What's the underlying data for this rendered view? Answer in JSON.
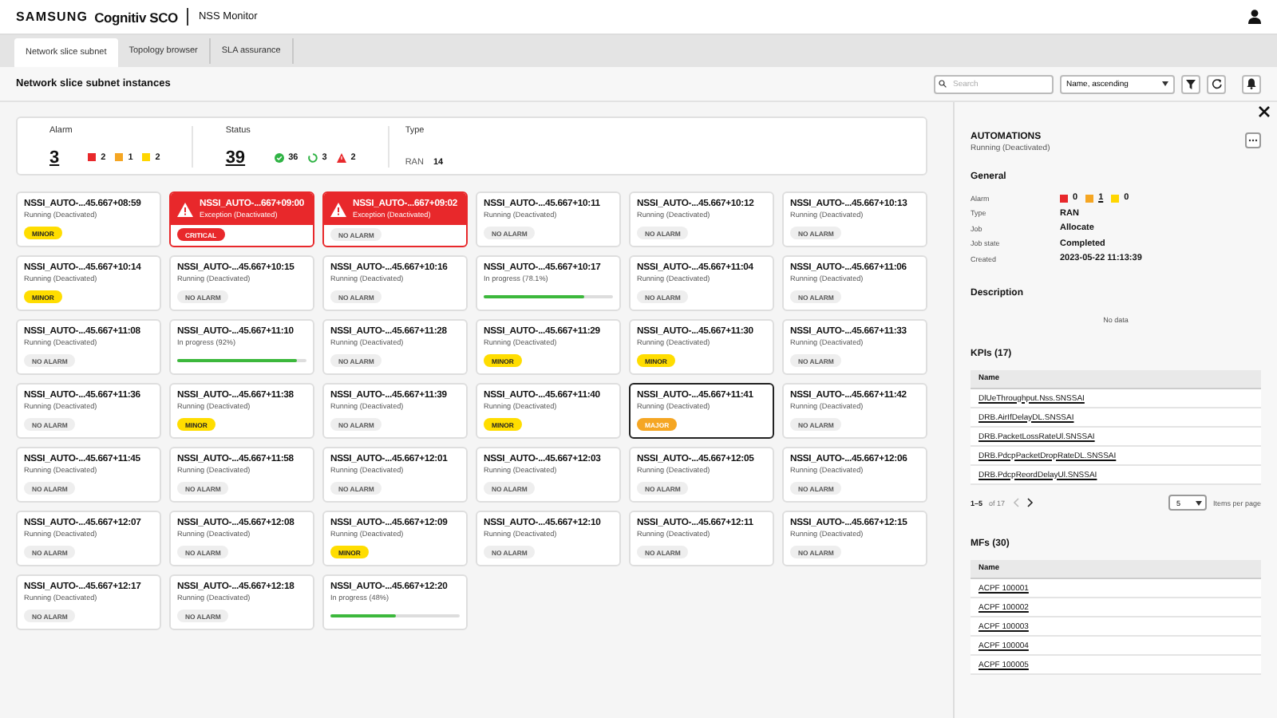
{
  "header": {
    "brand": "SAMSUNG",
    "product": "Cognitiv SCO",
    "app": "NSS Monitor"
  },
  "tabs": [
    {
      "label": "Network slice subnet",
      "selected": true
    },
    {
      "label": "Topology browser",
      "selected": false
    },
    {
      "label": "SLA assurance",
      "selected": false
    }
  ],
  "toolbar": {
    "title": "Network slice subnet instances",
    "search": {
      "placeholder": "Search"
    },
    "sort": "Name, ascending"
  },
  "summary": {
    "alarm": {
      "label": "Alarm",
      "total": "3",
      "counts": [
        {
          "color": "#e8282b",
          "count": "2"
        },
        {
          "color": "#f5a623",
          "count": "1"
        },
        {
          "color": "#ffd600",
          "count": "2"
        }
      ]
    },
    "status": {
      "label": "Status",
      "total": "39",
      "counts": [
        {
          "kind": "ok",
          "count": "36"
        },
        {
          "kind": "progress",
          "count": "3"
        },
        {
          "kind": "error",
          "count": "2"
        }
      ]
    },
    "type": {
      "label": "Type",
      "name": "RAN",
      "count": "14"
    }
  },
  "cards": [
    {
      "title": "NSSI_AUTO-...45.667+08:59",
      "status": "Running (Deactivated)",
      "kind": "normal",
      "badge": {
        "label": "MINOR",
        "color": "#ffdd00"
      },
      "selected": false
    },
    {
      "title": "NSSI_AUTO-...667+09:00",
      "status": "Exception (Deactivated)",
      "kind": "exception",
      "badge": {
        "label": "CRITICAL",
        "color": "#e8282b"
      },
      "selected": false
    },
    {
      "title": "NSSI_AUTO-...667+09:02",
      "status": "Exception (Deactivated)",
      "kind": "exception",
      "badge": {
        "label": "NO ALARM",
        "color": "#eeeeee"
      },
      "selected": false
    },
    {
      "title": "NSSI_AUTO-...45.667+10:11",
      "status": "Running (Deactivated)",
      "kind": "normal",
      "badge": {
        "label": "NO ALARM",
        "color": "#eeeeee"
      },
      "selected": false
    },
    {
      "title": "NSSI_AUTO-...45.667+10:12",
      "status": "Running (Deactivated)",
      "kind": "normal",
      "badge": {
        "label": "NO ALARM",
        "color": "#eeeeee"
      },
      "selected": false
    },
    {
      "title": "NSSI_AUTO-...45.667+10:13",
      "status": "Running (Deactivated)",
      "kind": "normal",
      "badge": {
        "label": "NO ALARM",
        "color": "#eeeeee"
      },
      "selected": false
    },
    {
      "title": "NSSI_AUTO-...45.667+10:14",
      "status": "Running (Deactivated)",
      "kind": "normal",
      "badge": {
        "label": "MINOR",
        "color": "#ffdd00"
      },
      "selected": false
    },
    {
      "title": "NSSI_AUTO-...45.667+10:15",
      "status": "Running (Deactivated)",
      "kind": "normal",
      "badge": {
        "label": "NO ALARM",
        "color": "#eeeeee"
      },
      "selected": false
    },
    {
      "title": "NSSI_AUTO-...45.667+10:16",
      "status": "Running (Deactivated)",
      "kind": "normal",
      "badge": {
        "label": "NO ALARM",
        "color": "#eeeeee"
      },
      "selected": false
    },
    {
      "title": "NSSI_AUTO-...45.667+10:17",
      "status": "In progress (78.1%)",
      "kind": "progress",
      "level": 0.78,
      "selected": false
    },
    {
      "title": "NSSI_AUTO-...45.667+11:04",
      "status": "Running (Deactivated)",
      "kind": "normal",
      "badge": {
        "label": "NO ALARM",
        "color": "#eeeeee"
      },
      "selected": false
    },
    {
      "title": "NSSI_AUTO-...45.667+11:06",
      "status": "Running (Deactivated)",
      "kind": "normal",
      "badge": {
        "label": "NO ALARM",
        "color": "#eeeeee"
      },
      "selected": false
    },
    {
      "title": "NSSI_AUTO-...45.667+11:08",
      "status": "Running (Deactivated)",
      "kind": "normal",
      "badge": {
        "label": "NO ALARM",
        "color": "#eeeeee"
      },
      "selected": false
    },
    {
      "title": "NSSI_AUTO-...45.667+11:10",
      "status": "In progress (92%)",
      "kind": "progress",
      "level": 0.92,
      "selected": false
    },
    {
      "title": "NSSI_AUTO-...45.667+11:28",
      "status": "Running (Deactivated)",
      "kind": "normal",
      "badge": {
        "label": "NO ALARM",
        "color": "#eeeeee"
      },
      "selected": false
    },
    {
      "title": "NSSI_AUTO-...45.667+11:29",
      "status": "Running (Deactivated)",
      "kind": "normal",
      "badge": {
        "label": "MINOR",
        "color": "#ffdd00"
      },
      "selected": false
    },
    {
      "title": "NSSI_AUTO-...45.667+11:30",
      "status": "Running (Deactivated)",
      "kind": "normal",
      "badge": {
        "label": "MINOR",
        "color": "#ffdd00"
      },
      "selected": false
    },
    {
      "title": "NSSI_AUTO-...45.667+11:33",
      "status": "Running (Deactivated)",
      "kind": "normal",
      "badge": {
        "label": "NO ALARM",
        "color": "#eeeeee"
      },
      "selected": false
    },
    {
      "title": "NSSI_AUTO-...45.667+11:36",
      "status": "Running (Deactivated)",
      "kind": "normal",
      "badge": {
        "label": "NO ALARM",
        "color": "#eeeeee"
      },
      "selected": false
    },
    {
      "title": "NSSI_AUTO-...45.667+11:38",
      "status": "Running (Deactivated)",
      "kind": "normal",
      "badge": {
        "label": "MINOR",
        "color": "#ffdd00"
      },
      "selected": false
    },
    {
      "title": "NSSI_AUTO-...45.667+11:39",
      "status": "Running (Deactivated)",
      "kind": "normal",
      "badge": {
        "label": "NO ALARM",
        "color": "#eeeeee"
      },
      "selected": false
    },
    {
      "title": "NSSI_AUTO-...45.667+11:40",
      "status": "Running (Deactivated)",
      "kind": "normal",
      "badge": {
        "label": "MINOR",
        "color": "#ffdd00"
      },
      "selected": false
    },
    {
      "title": "NSSI_AUTO-...45.667+11:41",
      "status": "Running (Deactivated)",
      "kind": "normal",
      "badge": {
        "label": "MAJOR",
        "color": "#f5a623"
      },
      "selected": true
    },
    {
      "title": "NSSI_AUTO-...45.667+11:42",
      "status": "Running (Deactivated)",
      "kind": "normal",
      "badge": {
        "label": "NO ALARM",
        "color": "#eeeeee"
      },
      "selected": false
    },
    {
      "title": "NSSI_AUTO-...45.667+11:45",
      "status": "Running (Deactivated)",
      "kind": "normal",
      "badge": {
        "label": "NO ALARM",
        "color": "#eeeeee"
      },
      "selected": false
    },
    {
      "title": "NSSI_AUTO-...45.667+11:58",
      "status": "Running (Deactivated)",
      "kind": "normal",
      "badge": {
        "label": "NO ALARM",
        "color": "#eeeeee"
      },
      "selected": false
    },
    {
      "title": "NSSI_AUTO-...45.667+12:01",
      "status": "Running (Deactivated)",
      "kind": "normal",
      "badge": {
        "label": "NO ALARM",
        "color": "#eeeeee"
      },
      "selected": false
    },
    {
      "title": "NSSI_AUTO-...45.667+12:03",
      "status": "Running (Deactivated)",
      "kind": "normal",
      "badge": {
        "label": "NO ALARM",
        "color": "#eeeeee"
      },
      "selected": false
    },
    {
      "title": "NSSI_AUTO-...45.667+12:05",
      "status": "Running (Deactivated)",
      "kind": "normal",
      "badge": {
        "label": "NO ALARM",
        "color": "#eeeeee"
      },
      "selected": false
    },
    {
      "title": "NSSI_AUTO-...45.667+12:06",
      "status": "Running (Deactivated)",
      "kind": "normal",
      "badge": {
        "label": "NO ALARM",
        "color": "#eeeeee"
      },
      "selected": false
    },
    {
      "title": "NSSI_AUTO-...45.667+12:07",
      "status": "Running (Deactivated)",
      "kind": "normal",
      "badge": {
        "label": "NO ALARM",
        "color": "#eeeeee"
      },
      "selected": false
    },
    {
      "title": "NSSI_AUTO-...45.667+12:08",
      "status": "Running (Deactivated)",
      "kind": "normal",
      "badge": {
        "label": "NO ALARM",
        "color": "#eeeeee"
      },
      "selected": false
    },
    {
      "title": "NSSI_AUTO-...45.667+12:09",
      "status": "Running (Deactivated)",
      "kind": "normal",
      "badge": {
        "label": "MINOR",
        "color": "#ffdd00"
      },
      "selected": false
    },
    {
      "title": "NSSI_AUTO-...45.667+12:10",
      "status": "Running (Deactivated)",
      "kind": "normal",
      "badge": {
        "label": "NO ALARM",
        "color": "#eeeeee"
      },
      "selected": false
    },
    {
      "title": "NSSI_AUTO-...45.667+12:11",
      "status": "Running (Deactivated)",
      "kind": "normal",
      "badge": {
        "label": "NO ALARM",
        "color": "#eeeeee"
      },
      "selected": false
    },
    {
      "title": "NSSI_AUTO-...45.667+12:15",
      "status": "Running (Deactivated)",
      "kind": "normal",
      "badge": {
        "label": "NO ALARM",
        "color": "#eeeeee"
      },
      "selected": false
    },
    {
      "title": "NSSI_AUTO-...45.667+12:17",
      "status": "Running (Deactivated)",
      "kind": "normal",
      "badge": {
        "label": "NO ALARM",
        "color": "#eeeeee"
      },
      "selected": false
    },
    {
      "title": "NSSI_AUTO-...45.667+12:18",
      "status": "Running (Deactivated)",
      "kind": "normal",
      "badge": {
        "label": "NO ALARM",
        "color": "#eeeeee"
      },
      "selected": false
    },
    {
      "title": "NSSI_AUTO-...45.667+12:20",
      "status": "In progress (48%)",
      "kind": "progress",
      "level": 0.5,
      "selected": false
    }
  ],
  "details": {
    "title": "AUTOMATIONS",
    "status": "Running (Deactivated)",
    "general": {
      "heading": "General",
      "rows": [
        {
          "kind": "alarm",
          "label": "Alarm",
          "counts": [
            {
              "color": "#e8282b",
              "count": "0",
              "link": false
            },
            {
              "color": "#f5a623",
              "count": "1",
              "link": true
            },
            {
              "color": "#ffd600",
              "count": "0",
              "link": false
            }
          ]
        },
        {
          "kind": "text",
          "label": "Type",
          "value": "RAN"
        },
        {
          "kind": "text",
          "label": "Job",
          "value": "Allocate"
        },
        {
          "kind": "text",
          "label": "Job state",
          "value": "Completed"
        },
        {
          "kind": "text",
          "label": "Created",
          "value": "2023-05-22 11:13:39"
        }
      ]
    },
    "description": {
      "heading": "Description",
      "empty": "No data"
    },
    "kpis": {
      "heading": "KPIs (17)",
      "column": "Name",
      "rows": [
        "DlUeThroughput.Nss.SNSSAI",
        "DRB.AirIfDelayDL.SNSSAI",
        "DRB.PacketLossRateUl.SNSSAI",
        "DRB.PdcpPacketDropRateDL.SNSSAI",
        "DRB.PdcpReordDelayUl.SNSSAI"
      ],
      "pagination": {
        "range": "1–5",
        "of": "of 17",
        "prev_disabled": true,
        "next_disabled": false,
        "per_page": "5",
        "per_page_label": "Items per page"
      }
    },
    "mfs": {
      "heading": "MFs (30)",
      "column": "Name",
      "rows": [
        "ACPF 100001",
        "ACPF 100002",
        "ACPF 100003",
        "ACPF 100004",
        "ACPF 100005"
      ]
    }
  }
}
